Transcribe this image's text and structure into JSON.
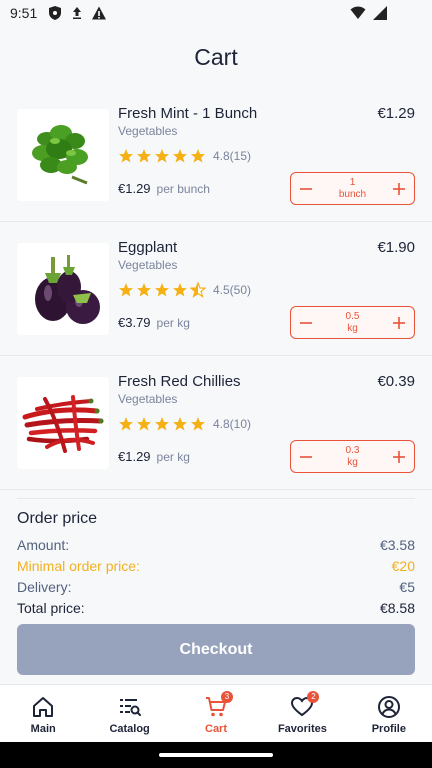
{
  "status": {
    "time": "9:51"
  },
  "page": {
    "title": "Cart"
  },
  "items": [
    {
      "name": "Fresh Mint - 1 Bunch",
      "category": "Vegetables",
      "total": "€1.29",
      "rating": 5,
      "rating_text": "4.8(15)",
      "price": "€1.29",
      "per": "per bunch",
      "qty_value": "1",
      "qty_unit": "bunch",
      "image_icon": "mint-image"
    },
    {
      "name": "Eggplant",
      "category": "Vegetables",
      "total": "€1.90",
      "rating": 4.5,
      "rating_text": "4.5(50)",
      "price": "€3.79",
      "per": "per kg",
      "qty_value": "0.5",
      "qty_unit": "kg",
      "image_icon": "eggplant-image"
    },
    {
      "name": "Fresh Red Chillies",
      "category": "Vegetables",
      "total": "€0.39",
      "rating": 5,
      "rating_text": "4.8(10)",
      "price": "€1.29",
      "per": "per kg",
      "qty_value": "0.3",
      "qty_unit": "kg",
      "image_icon": "chillies-image"
    }
  ],
  "order": {
    "heading": "Order price",
    "amount_label": "Amount:",
    "amount_value": "€3.58",
    "minimal_label": "Minimal order price:",
    "minimal_value": "€20",
    "delivery_label": "Delivery:",
    "delivery_value": "€5",
    "total_label": "Total price:",
    "total_value": "€8.58"
  },
  "checkout_label": "Checkout",
  "nav": {
    "main": "Main",
    "catalog": "Catalog",
    "cart": "Cart",
    "cart_badge": "3",
    "favorites": "Favorites",
    "favorites_badge": "2",
    "profile": "Profile"
  },
  "colors": {
    "accent": "#e8533a",
    "star": "#f5b014",
    "warning": "#f2b01e",
    "checkout_disabled": "#97a3bd"
  }
}
